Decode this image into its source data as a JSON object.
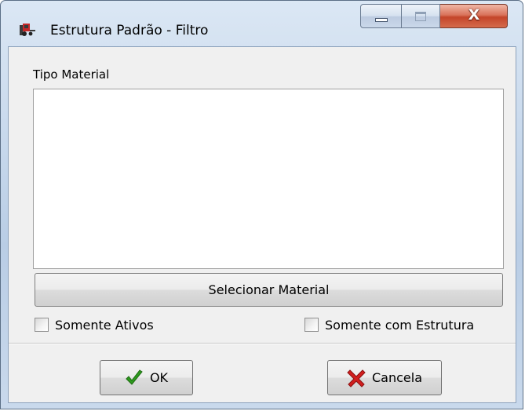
{
  "window": {
    "title": "Estrutura Padrão - Filtro",
    "app_icon": "forklift-icon",
    "caption_buttons": {
      "minimize_icon": "minimize-icon",
      "maximize_icon": "maximize-icon",
      "close_glyph": "X"
    }
  },
  "filter": {
    "list_label": "Tipo Material",
    "list_items": [],
    "select_button_label": "Selecionar Material",
    "only_active": {
      "label": "Somente Ativos",
      "checked": false
    },
    "only_with_structure": {
      "label": "Somente com Estrutura",
      "checked": false
    }
  },
  "footer": {
    "ok_label": "OK",
    "ok_icon": "checkmark-icon",
    "cancel_label": "Cancela",
    "cancel_icon": "red-x-icon"
  },
  "colors": {
    "frame_accent": "#c7d8ec",
    "close_button": "#c4452a",
    "ok_check": "#2e9a1e",
    "cancel_x": "#d21f1f"
  }
}
